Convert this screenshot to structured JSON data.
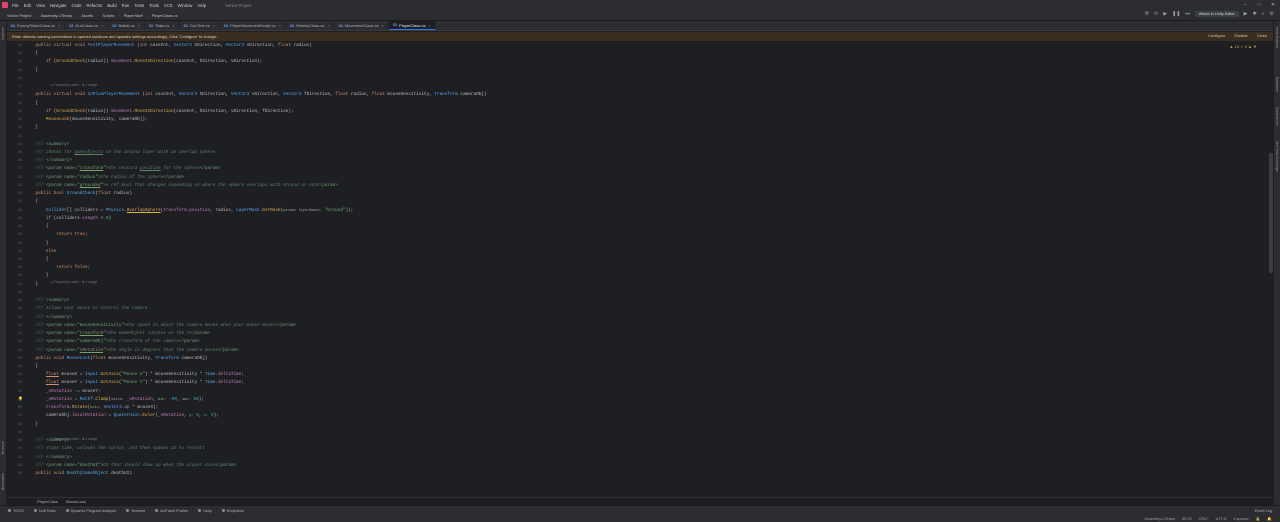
{
  "menubar": {
    "items": [
      "File",
      "Edit",
      "View",
      "Navigate",
      "Code",
      "Refactor",
      "Build",
      "Run",
      "Tests",
      "Tools",
      "VCS",
      "Window",
      "Help"
    ],
    "project": "Senior Project"
  },
  "navbar": {
    "crumbs": [
      "Senior Project",
      "Assembly-CSharp",
      "Assets",
      "Scripts",
      "PlayerStuff",
      "PlayerClass.cs"
    ],
    "attach_label": "Attach to Unity Editor"
  },
  "tabs": [
    {
      "label": "EnemyStats/Class.cs",
      "active": false
    },
    {
      "label": "GunClass.cs",
      "active": false
    },
    {
      "label": "BulletLcs",
      "active": false
    },
    {
      "label": "Stats.cs",
      "active": false
    },
    {
      "label": "GunTest.cs",
      "active": false
    },
    {
      "label": "PlayerMovementScript.cs",
      "active": false
    },
    {
      "label": "WheelyClass.cs",
      "active": false
    },
    {
      "label": "MovementClass.cs",
      "active": false
    },
    {
      "label": "PlayerClass.cs",
      "active": true
    }
  ],
  "notice": {
    "text": "Rider detects naming conventions in opened solutions and updates settings accordingly. Click 'Configure' to change.",
    "actions": [
      "Configure",
      "Disable",
      "Close"
    ]
  },
  "indicators": "▲ 15  ✓ 5  ▲  ▼",
  "left_tools": [
    "Explorer",
    "Structure",
    "Bookmarks"
  ],
  "right_tools": [
    "Unity Explorer",
    "Database",
    "Notifications",
    "Unit Tests Coverage"
  ],
  "code_lines": [
    {
      "n": "12",
      "html": "    <span class='kw'>public virtual void</span> <span class='fn'>TestPlayerMovement</span> (<span class='kw'>int</span> caseInt, <span class='ty'>Vector3</span> hDirection, <span class='ty'>Vector3</span> vDirection, <span class='kw'>float</span> radius)"
    },
    {
      "n": "13",
      "html": "    {"
    },
    {
      "n": "14",
      "html": "        <span class='kw'>if</span> (<span class='mt'>GroundCheck</span>(radius)) <span class='fld'>movement</span>.<span class='mt'>MoveInDirection</span>(caseInt, hDirection, vDirection);"
    },
    {
      "n": "15",
      "html": "    }"
    },
    {
      "n": "16",
      "html": ""
    },
    {
      "n": "17",
      "html": ""
    },
    {
      "n": "18",
      "html": "    <span class='kw'>public virtual void</span> <span class='fn'>CoPlusPlayerMovement</span> (<span class='kw'>int</span> caseInt, <span class='ty'>Vector3</span> hDirection, <span class='ty'>Vector3</span> vDirection, <span class='ty'>Vector3</span> fDirection, <span class='kw'>float</span> radius, <span class='kw'>float</span> mouseSensitivity, <span class='ty'>Transform</span> cameraObj)"
    },
    {
      "n": "19",
      "html": "    {"
    },
    {
      "n": "20",
      "html": "        <span class='kw'>if</span> (<span class='mt'>GroundCheck</span>(radius)) <span class='fld'>movement</span>.<span class='mt'>MoveInDirection</span>(caseInt, hDirection, vDirection, fDirection);"
    },
    {
      "n": "21",
      "html": "        <span class='mt'>MouseLook</span>(mouseSensitivity, cameraObj);"
    },
    {
      "n": "22",
      "html": "    }"
    },
    {
      "n": "23",
      "html": ""
    },
    {
      "n": "24",
      "html": "    <span class='cm'>/// </span><span class='tag'>&lt;summary&gt;</span>"
    },
    {
      "n": "25",
      "html": "    <span class='cm'>/// checks for <u>gameobjects</u> on the Ground layer with an overlap sphere</span>"
    },
    {
      "n": "26",
      "html": "    <span class='cm'>/// </span><span class='tag'>&lt;/summary&gt;</span>"
    },
    {
      "n": "27",
      "html": "    <span class='cm'>/// </span><span class='tag'>&lt;param name=</span><span class='str'>\"</span><span class='ref'>transform</span><span class='str'>\"</span><span class='tag'>&gt;</span><span class='cm'>the Vector3 <u>position</u> for the sphere</span><span class='tag'>&lt;/param&gt;</span>"
    },
    {
      "n": "28",
      "html": "    <span class='cm'>/// </span><span class='tag'>&lt;param name=</span><span class='str'>\"radius\"</span><span class='tag'>&gt;</span><span class='cm'>the radius of the sphere</span><span class='tag'>&lt;/param&gt;</span>"
    },
    {
      "n": "29",
      "html": "    <span class='cm'>/// </span><span class='tag'>&lt;param name=</span><span class='str'>\"</span><span class='ref'>grounded</span><span class='str'>\"</span><span class='tag'>&gt;</span><span class='cm'>a ref bool that changes depending on where the sphere overlaps with Ground or not</span><span class='tag'>&lt;/param&gt;</span>"
    },
    {
      "n": "30",
      "html": "    <span class='kw'>public bool</span> <span class='fn'>GroundCheck</span>(<span class='kw'>float</span> radius)"
    },
    {
      "n": "31",
      "html": "    {"
    },
    {
      "n": "32",
      "html": "        <span class='ty'>Collider</span>[] colliders = <span class='ty'>Physics</span>.<span class='mt'><u>OverlapSphere</u></span>(<span class='fld'>transform</span>.<span class='fld'>position</span>, radius, <span class='ty'>LayerMask</span>.<span class='mt'>GetMask</span>(<span class='prm'>params layerNames:</span> <span class='str'>\"Ground\"</span>));"
    },
    {
      "n": "33",
      "html": "        <span class='kw'>if</span> (colliders.<span class='fld'>Length</span> &gt; <span class='num'>0</span>)"
    },
    {
      "n": "34",
      "html": "        {"
    },
    {
      "n": "35",
      "html": "            <span class='kw'>return true</span>;"
    },
    {
      "n": "36",
      "html": "        }"
    },
    {
      "n": "37",
      "html": "        <span class='kw'>else</span>"
    },
    {
      "n": "38",
      "html": "        {"
    },
    {
      "n": "39",
      "html": "            <span class='kw'>return false</span>;"
    },
    {
      "n": "40",
      "html": "        }"
    },
    {
      "n": "41",
      "html": "    }"
    },
    {
      "n": "42",
      "html": ""
    },
    {
      "n": "43",
      "html": "    <span class='cm'>/// </span><span class='tag'>&lt;summary&gt;</span>"
    },
    {
      "n": "44",
      "html": "    <span class='cm'>/// Allows your mouse to control the camera</span>"
    },
    {
      "n": "45",
      "html": "    <span class='cm'>/// </span><span class='tag'>&lt;/summary&gt;</span>"
    },
    {
      "n": "46",
      "html": "    <span class='cm'>/// </span><span class='tag'>&lt;param name=</span><span class='str'>\"mouseSensitivity\"</span><span class='tag'>&gt;</span><span class='cm'>the speed in which the camera moves when your mouse moves</span><span class='tag'>&lt;/param&gt;</span>"
    },
    {
      "n": "47",
      "html": "    <span class='cm'>/// </span><span class='tag'>&lt;param name=</span><span class='str'>\"</span><span class='ref'>transform</span><span class='str'>\"</span><span class='tag'>&gt;</span><span class='cm'>the GameObject rotates on the Y</span><span class='tag'>&lt;/param&gt;</span>"
    },
    {
      "n": "48",
      "html": "    <span class='cm'>/// </span><span class='tag'>&lt;param name=</span><span class='str'>\"cameraObj\"</span><span class='tag'>&gt;</span><span class='cm'>the transform of the camera</span><span class='tag'>&lt;/param&gt;</span>"
    },
    {
      "n": "49",
      "html": "    <span class='cm'>/// </span><span class='tag'>&lt;param name=</span><span class='str'>\"</span><span class='ref'>xRotation</span><span class='str'>\"</span><span class='tag'>&gt;</span><span class='cm'>the angle in degrees that the camera moves</span><span class='tag'>&lt;/param&gt;</span>"
    },
    {
      "n": "50",
      "html": "    <span class='kw'>public void</span> <span class='fn'>MouseLook</span>(<span class='kw'>float</span> mouseSensitivity, <span class='ty'>Transform</span> cameraObj)"
    },
    {
      "n": "51",
      "html": "    {"
    },
    {
      "n": "52",
      "html": "        <span class='kw'><u>float</u></span> mouseX = <span class='ty'>Input</span>.<span class='mt'>GetAxis</span>(<span class='str'>\"Mouse X\"</span>) * mouseSensitivity * <span class='ty'>Time</span>.<span class='fld'>deltaTime</span>;"
    },
    {
      "n": "53",
      "html": "        <span class='kw'><u>float</u></span> mouseY = <span class='ty'>Input</span>.<span class='mt'>GetAxis</span>(<span class='str'>\"Mouse Y\"</span>) * mouseSensitivity * <span class='ty'>Time</span>.<span class='fld'>deltaTime</span>;"
    },
    {
      "n": "54",
      "html": "        <span class='fld'>_xRotation</span> -= mouseY;"
    },
    {
      "n": "55",
      "html": "        <span class='fld'>_xRotation</span> = <span class='ty'>Mathf</span>.<span class='mt'>Clamp</span>(<span class='prm'>value:</span> <span class='fld'>_xRotation</span>, <span class='prm'>min:</span> <span class='num'>-90</span>, <span class='prm'>max:</span> <span class='num'>90</span>);"
    },
    {
      "n": "56",
      "html": "        <span class='fld'>transform</span>.<span class='mt'>Rotate</span>(<span class='prm'>axis:</span> <span class='ty'>Vector3</span>.<span class='fld'>up</span> * mouseX);"
    },
    {
      "n": "57",
      "html": "        cameraObj.<span class='fld'>localRotation</span> = <span class='ty'>Quaternion</span>.<span class='mt'>Euler</span>(<span class='fld'>_xRotation</span>, <span class='prm'>y:</span> <span class='num'>0</span>, <span class='prm'>z:</span> <span class='num'>0</span>);"
    },
    {
      "n": "58",
      "html": "    }"
    },
    {
      "n": "59",
      "html": ""
    },
    {
      "n": "60",
      "html": "    <span class='cm'>/// </span><span class='tag'>&lt;summary&gt;</span>"
    },
    {
      "n": "61",
      "html": "    <span class='cm'>/// stops time, unlocks the cursor, and then spawns UI to restart</span>"
    },
    {
      "n": "62",
      "html": "    <span class='cm'>/// </span><span class='tag'>&lt;/summary&gt;</span>"
    },
    {
      "n": "63",
      "html": "    <span class='cm'>/// </span><span class='tag'>&lt;param name=</span><span class='str'>\"deathUI\"</span><span class='tag'>&gt;</span><span class='cm'>UI that should show up when the player dies</span><span class='tag'>&lt;/param&gt;</span>"
    },
    {
      "n": "64",
      "html": "    <span class='kw'>public void</span> <span class='fn'>Death</span>(<span class='ty'>GameObject</span> deathUI)"
    }
  ],
  "hints": [
    {
      "line": 5,
      "text": "● Frequently called   ⊕ 1 usage"
    },
    {
      "line": 29,
      "text": "● Frequently called   ⊕ 1 usage"
    },
    {
      "line": 48,
      "text": "● Frequently called   ⊕ 1 usage"
    }
  ],
  "bottom_crumbs": [
    "PlayerClass",
    "MouseLook"
  ],
  "tool_windows": [
    "TODO",
    "Unit Tests",
    "Dynamic Program Analysis",
    "Terminal",
    "dotTrace Profiler",
    "Unity",
    "Endpoints"
  ],
  "event_log": "Event Log",
  "status": [
    "Assembly-CSharp",
    "55:33",
    "CRLF",
    "UTF-8",
    "4 spaces"
  ]
}
